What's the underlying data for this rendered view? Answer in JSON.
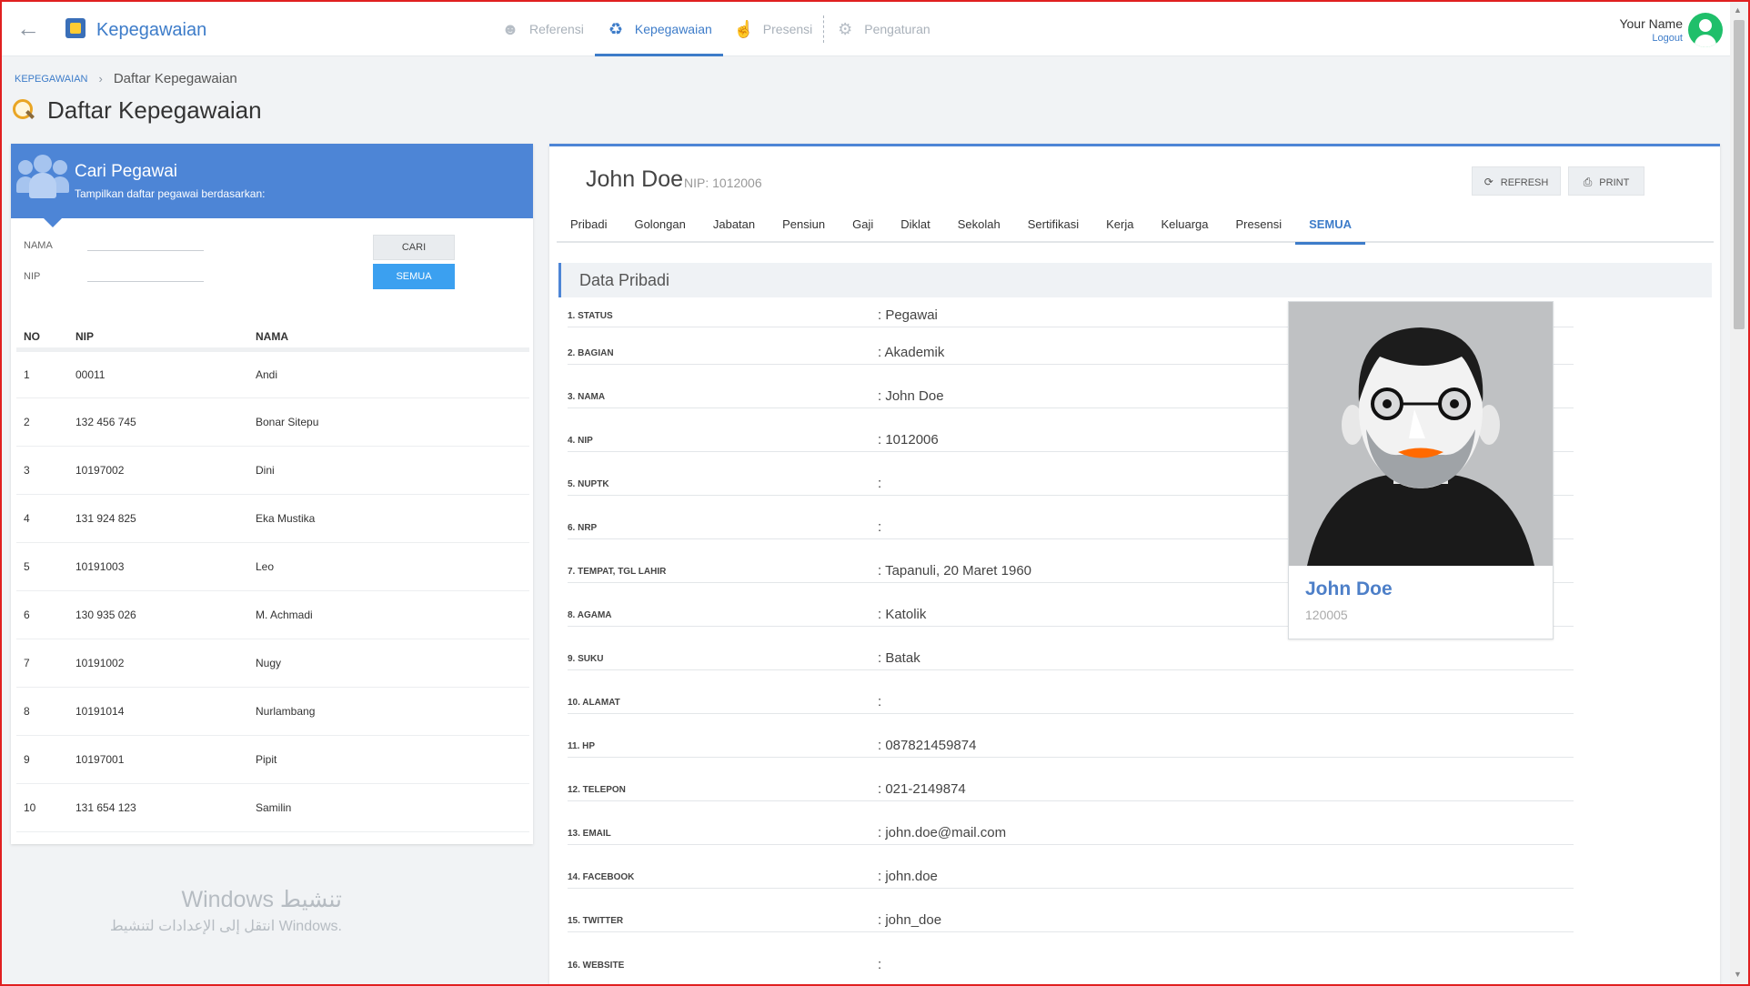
{
  "header": {
    "app_title": "Kepegawaian",
    "nav": [
      {
        "label": "Referensi",
        "icon": "people-icon"
      },
      {
        "label": "Kepegawaian",
        "icon": "staff-icon"
      },
      {
        "label": "Presensi",
        "icon": "hand-pointer-icon"
      },
      {
        "label": "Pengaturan",
        "icon": "gear-icon"
      }
    ],
    "user_name": "Your Name",
    "logout_label": "Logout"
  },
  "breadcrumb": {
    "root": "KEPEGAWAIAN",
    "separator": "›",
    "current": "Daftar Kepegawaian"
  },
  "page_title": "Daftar Kepegawaian",
  "search": {
    "title": "Cari Pegawai",
    "subtitle": "Tampilkan daftar pegawai berdasarkan:",
    "nama_label": "NAMA",
    "nip_label": "NIP",
    "cari_label": "CARI",
    "semua_label": "SEMUA"
  },
  "employees": {
    "headers": [
      "NO",
      "NIP",
      "NAMA"
    ],
    "rows": [
      [
        "1",
        "00011",
        "Andi"
      ],
      [
        "2",
        "132 456 745",
        "Bonar Sitepu"
      ],
      [
        "3",
        "10197002",
        "Dini"
      ],
      [
        "4",
        "131 924 825",
        "Eka Mustika"
      ],
      [
        "5",
        "10191003",
        "Leo"
      ],
      [
        "6",
        "130 935 026",
        "M. Achmadi"
      ],
      [
        "7",
        "10191002",
        "Nugy"
      ],
      [
        "8",
        "10191014",
        "Nurlambang"
      ],
      [
        "9",
        "10197001",
        "Pipit"
      ],
      [
        "10",
        "131 654 123",
        "Samilin"
      ]
    ]
  },
  "watermark": {
    "line1": "Windows تنشيط",
    "line2": "انتقل إلى الإعدادات لتنشيط Windows."
  },
  "detail": {
    "name": "John Doe",
    "nip": "NIP: 1012006",
    "refresh_label": "REFRESH",
    "print_label": "PRINT",
    "tabs": [
      "Pribadi",
      "Golongan",
      "Jabatan",
      "Pensiun",
      "Gaji",
      "Diklat",
      "Sekolah",
      "Sertifikasi",
      "Kerja",
      "Keluarga",
      "Presensi",
      "SEMUA"
    ],
    "active_tab": "SEMUA",
    "section_title": "Data Pribadi",
    "fields": [
      {
        "label": "1. STATUS",
        "value": ": Pegawai"
      },
      {
        "label": "2. BAGIAN",
        "value": ": Akademik"
      },
      {
        "label": "3. NAMA",
        "value": ": John Doe"
      },
      {
        "label": "4. NIP",
        "value": ": 1012006"
      },
      {
        "label": "5. NUPTK",
        "value": ":"
      },
      {
        "label": "6. NRP",
        "value": ":"
      },
      {
        "label": "7. TEMPAT, TGL LAHIR",
        "value": ": Tapanuli, 20 Maret 1960"
      },
      {
        "label": "8. AGAMA",
        "value": ": Katolik"
      },
      {
        "label": "9. SUKU",
        "value": ": Batak"
      },
      {
        "label": "10. ALAMAT",
        "value": ":"
      },
      {
        "label": "11. HP",
        "value": ": 087821459874"
      },
      {
        "label": "12. TELEPON",
        "value": ": 021-2149874"
      },
      {
        "label": "13. EMAIL",
        "value": ": john.doe@mail.com"
      },
      {
        "label": "14. FACEBOOK",
        "value": ": john.doe"
      },
      {
        "label": "15. TWITTER",
        "value": ": john_doe"
      },
      {
        "label": "16. WEBSITE",
        "value": ":"
      }
    ],
    "card_name": "John Doe",
    "card_nip": "120005"
  },
  "colors": {
    "accent": "#4d85d6",
    "link": "#3d7cc9",
    "semua_button": "#3ba0f0",
    "avatar": "#1fbf6a"
  }
}
